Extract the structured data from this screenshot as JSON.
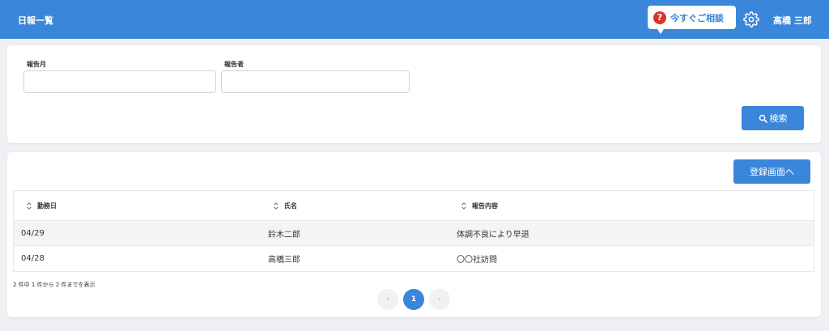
{
  "header": {
    "title": "日報一覧",
    "consult_label": "今すぐご相談",
    "user_name": "高橋 三郎"
  },
  "search": {
    "month_label": "報告月",
    "month_value": "",
    "reporter_label": "報告者",
    "reporter_value": "",
    "search_label": "検索"
  },
  "list": {
    "register_label": "登録画面へ",
    "columns": [
      "勤務日",
      "氏名",
      "報告内容"
    ],
    "rows": [
      [
        "04/29",
        "鈴木二郎",
        "体調不良により早退"
      ],
      [
        "04/28",
        "高橋三郎",
        "〇〇社訪問"
      ]
    ],
    "summary": "2 件中 1 件から 2 件までを表示",
    "pagination": {
      "prev": "‹",
      "current": "1",
      "next": "›"
    }
  },
  "colors": {
    "header": "#3a86da",
    "primary": "#3a86da",
    "help_icon": "#d9342b"
  },
  "icons": [
    "question-icon",
    "gear-icon",
    "search-icon",
    "sort-icon"
  ]
}
